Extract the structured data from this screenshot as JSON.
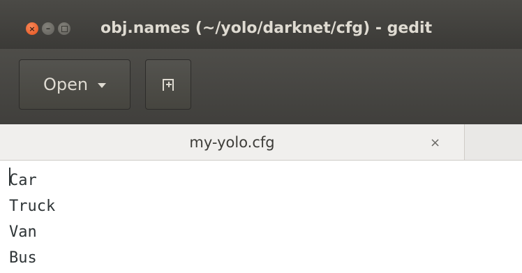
{
  "window": {
    "title": "obj.names (~/yolo/darknet/cfg) - gedit",
    "controls": [
      "close-icon",
      "minimize-icon",
      "maximize-icon"
    ]
  },
  "toolbar": {
    "open_label": "Open",
    "open_icon": "chevron-down-icon",
    "new_tab_icon": "new-document-icon"
  },
  "tabs": [
    {
      "label": "my-yolo.cfg",
      "close_label": "×"
    }
  ],
  "editor": {
    "lines": [
      "Car",
      "Truck",
      "Van",
      "Bus"
    ]
  },
  "colors": {
    "close_button": "#e3521c",
    "titlebar": "#3b3a37",
    "toolbar": "#4e4d49"
  }
}
